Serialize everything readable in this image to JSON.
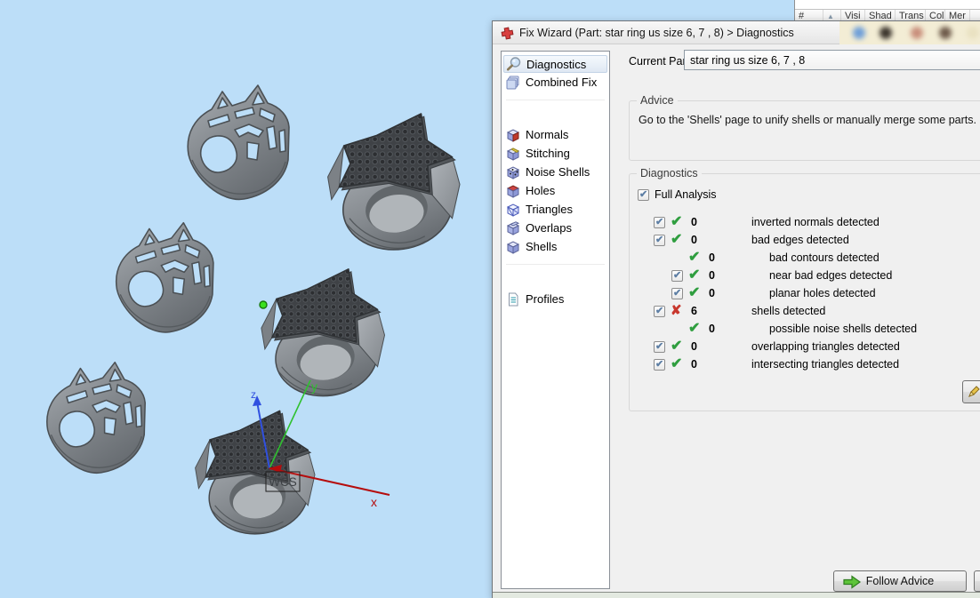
{
  "window": {
    "viewport_background": "#bcdef8"
  },
  "parts_panel": {
    "columns": [
      "#",
      "Visi",
      "Shad",
      "Trans",
      "Col",
      "Mer"
    ],
    "sort_icon": "▲"
  },
  "dialog": {
    "title": "Fix Wizard (Part: star ring us size 6, 7 , 8) > Diagnostics",
    "current_part": {
      "label": "Current Part:",
      "value": "star ring us size 6, 7 , 8"
    },
    "sidebar": [
      {
        "label": "Diagnostics",
        "icon": "diagnostics",
        "selected": true,
        "group": 0
      },
      {
        "label": "Combined Fix",
        "icon": "combined-fix",
        "selected": false,
        "group": 0
      },
      {
        "label": "Normals",
        "icon": "normals",
        "selected": false,
        "group": 1
      },
      {
        "label": "Stitching",
        "icon": "stitching",
        "selected": false,
        "group": 1
      },
      {
        "label": "Noise Shells",
        "icon": "noise-shells",
        "selected": false,
        "group": 1
      },
      {
        "label": "Holes",
        "icon": "holes",
        "selected": false,
        "group": 1
      },
      {
        "label": "Triangles",
        "icon": "triangles",
        "selected": false,
        "group": 1
      },
      {
        "label": "Overlaps",
        "icon": "overlaps",
        "selected": false,
        "group": 1
      },
      {
        "label": "Shells",
        "icon": "shells",
        "selected": false,
        "group": 1
      },
      {
        "label": "Profiles",
        "icon": "profiles",
        "selected": false,
        "group": 2
      }
    ],
    "advice": {
      "title": "Advice",
      "text": "Go to the 'Shells' page to unify shells or manually merge some parts."
    },
    "diagnostics": {
      "title": "Diagnostics",
      "full_analysis": {
        "label": "Full Analysis",
        "checked": true
      },
      "rows": [
        {
          "checkbox": true,
          "status": "ok",
          "count": "0",
          "label": "inverted normals detected",
          "indent": 0
        },
        {
          "checkbox": true,
          "status": "ok",
          "count": "0",
          "label": "bad edges detected",
          "indent": 0
        },
        {
          "checkbox": false,
          "status": "ok",
          "count": "0",
          "label": "bad contours detected",
          "indent": 1
        },
        {
          "checkbox": true,
          "status": "ok",
          "count": "0",
          "label": "near bad edges detected",
          "indent": 1
        },
        {
          "checkbox": true,
          "status": "ok",
          "count": "0",
          "label": "planar holes detected",
          "indent": 1
        },
        {
          "checkbox": true,
          "status": "error",
          "count": "6",
          "label": "shells detected",
          "indent": 0
        },
        {
          "checkbox": false,
          "status": "ok",
          "count": "0",
          "label": "possible noise shells detected",
          "indent": 1
        },
        {
          "checkbox": true,
          "status": "ok",
          "count": "0",
          "label": "overlapping triangles detected",
          "indent": 0
        },
        {
          "checkbox": true,
          "status": "ok",
          "count": "0",
          "label": "intersecting triangles detected",
          "indent": 0
        }
      ],
      "status_colors": {
        "ok": "#2f9e3f",
        "error": "#c8372d"
      }
    },
    "buttons": {
      "follow_advice": "Follow Advice"
    }
  },
  "viewport": {
    "axis": {
      "x": "x",
      "y": "y",
      "z": "z",
      "wcs": "WCS",
      "x_color": "#b50d0d",
      "y_color": "#2fc12f",
      "z_color": "#3050e0"
    }
  }
}
